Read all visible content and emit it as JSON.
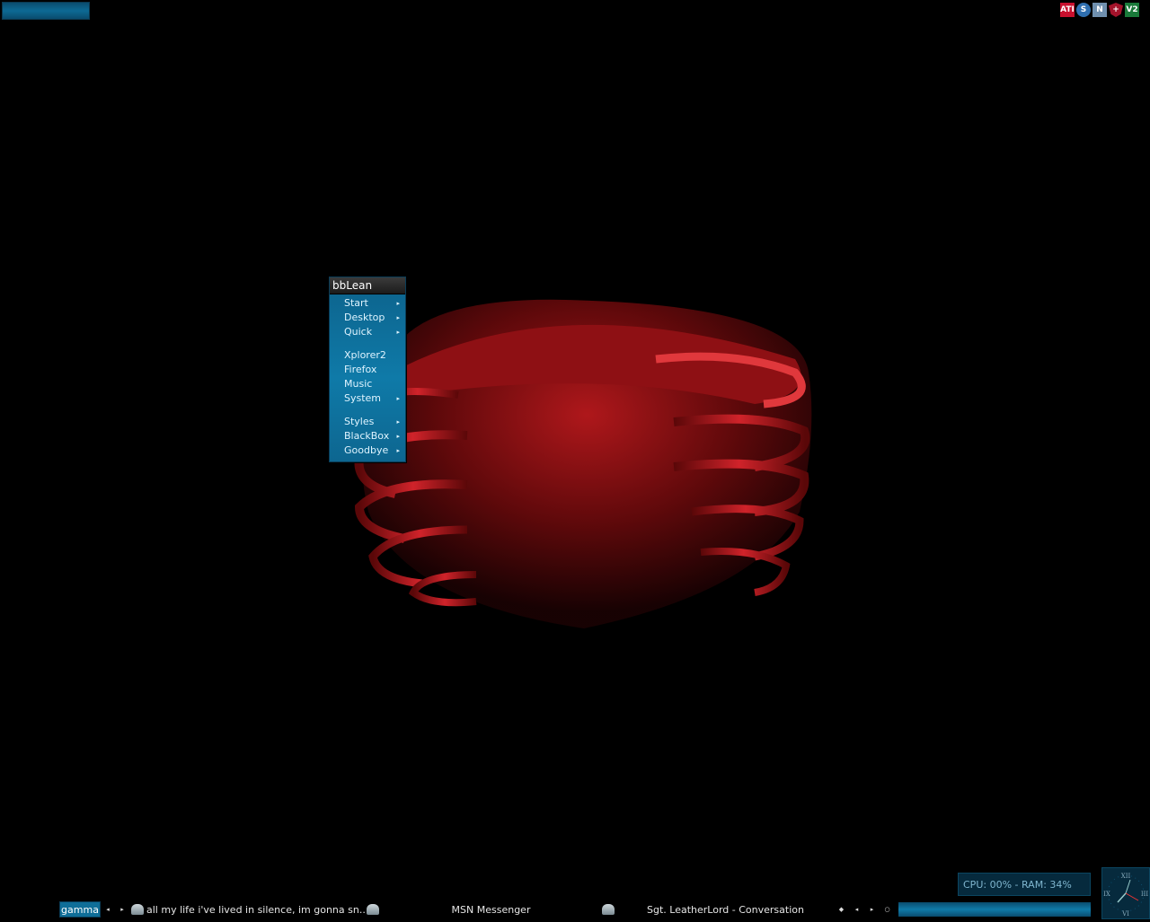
{
  "desktop": {
    "wallpaper_icon": "red-ribcage-artwork"
  },
  "tray": {
    "icons": [
      {
        "name": "ati-icon",
        "label": "ATI"
      },
      {
        "name": "system-icon",
        "label": "S"
      },
      {
        "name": "network-icon",
        "label": "N"
      },
      {
        "name": "security-shield-icon",
        "label": "+"
      },
      {
        "name": "v2-icon",
        "label": "V2"
      }
    ]
  },
  "menu": {
    "title": "bbLean",
    "items": [
      {
        "label": "Start",
        "submenu": true
      },
      {
        "label": "Desktop",
        "submenu": true
      },
      {
        "label": "Quick",
        "submenu": true
      },
      {
        "label": "Xplorer2",
        "submenu": false
      },
      {
        "label": "Firefox",
        "submenu": false
      },
      {
        "label": "Music",
        "submenu": false
      },
      {
        "label": "System",
        "submenu": true
      },
      {
        "label": "Styles",
        "submenu": true
      },
      {
        "label": "BlackBox",
        "submenu": true
      },
      {
        "label": "Goodbye",
        "submenu": true
      }
    ],
    "arrow_glyph": "▸"
  },
  "monitor": {
    "text": "CPU: 00% - RAM: 34%"
  },
  "clock": {
    "numerals": [
      "XII",
      "III",
      "VI",
      "IX"
    ]
  },
  "taskbar": {
    "workspace": "gamma",
    "prev_glyph": "◂",
    "next_glyph": "▸",
    "tasks": [
      {
        "title": "all my life i've lived in silence, im gonna sn...",
        "icon": "msn-conversation-icon"
      },
      {
        "title": "MSN Messenger",
        "icon": "msn-messenger-icon"
      },
      {
        "title": "Sgt. LeatherLord - Conversation",
        "icon": "msn-conversation-icon"
      }
    ],
    "nav_glyphs": [
      "◆",
      "◂",
      "▸",
      "○"
    ]
  },
  "colors": {
    "accent": "#0f7aa8",
    "menu_bg": "#0e6a96",
    "background": "#000000",
    "wallpaper_red": "#b0141a"
  }
}
